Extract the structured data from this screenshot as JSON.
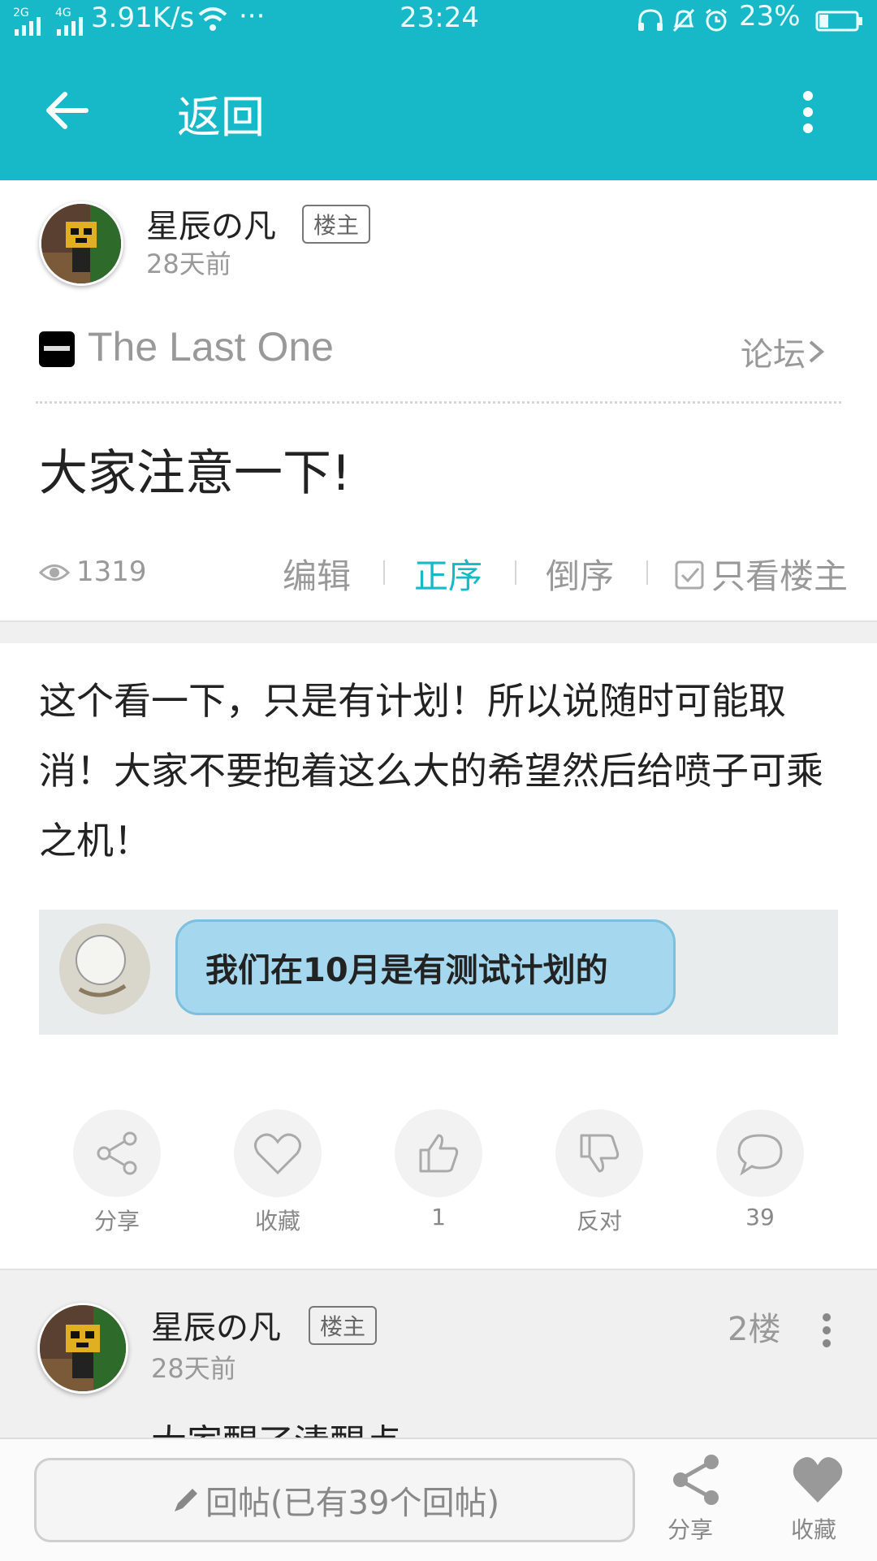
{
  "status_bar": {
    "net1": "2G",
    "net2": "4G",
    "speed": "3.91K/s",
    "more": "···",
    "time": "23:24",
    "battery": "23%"
  },
  "header": {
    "title": "返回"
  },
  "post": {
    "author": "星辰の凡",
    "author_badge": "楼主",
    "time": "28天前",
    "forum_name": "The Last One",
    "forum_link": "论坛",
    "title": "大家注意一下!",
    "views": "1319",
    "tools": {
      "edit": "编辑",
      "asc": "正序",
      "desc": "倒序",
      "only_op": "只看楼主"
    },
    "body": "这个看一下，只是有计划！所以说随时可能取消！大家不要抱着这么大的希望然后给喷子可乘之机！",
    "image_caption": "我们在10月是有测试计划的",
    "actions": {
      "share": "分享",
      "favorite": "收藏",
      "like_count": "1",
      "oppose": "反对",
      "comment_count": "39"
    }
  },
  "reply": {
    "author": "星辰の凡",
    "author_badge": "楼主",
    "time": "28天前",
    "floor": "2楼",
    "text": "大家醒了清醒点"
  },
  "bottom_bar": {
    "reply_placeholder": "回帖(已有39个回帖)",
    "share": "分享",
    "favorite": "收藏"
  },
  "colors": {
    "accent": "#17b8c7",
    "text_dark": "#222222",
    "text_gray": "#999999"
  }
}
